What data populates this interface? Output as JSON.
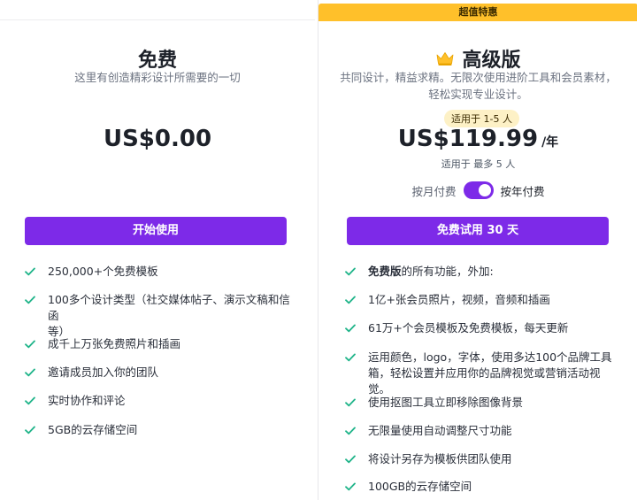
{
  "free": {
    "title": "免费",
    "subtitle": "这里有创造精彩设计所需要的一切",
    "price": "US$0.00",
    "cta": "开始使用",
    "features": [
      "250,000+个免费模板",
      "100多个设计类型（社交媒体帖子、演示文稿和信函",
      "等）",
      "成千上万张免费照片和插画",
      "邀请成员加入你的团队",
      "实时协作和评论",
      "5GB的云存储空间"
    ]
  },
  "pro": {
    "badge": "超值特惠",
    "title": "高级版",
    "subtitle_line1": "共同设计，精益求精。无限次使用进阶工具和会员素材，",
    "subtitle_line2": "轻松实现专业设计。",
    "seat_pill": "适用于 1-5 人",
    "price": "US$119.99",
    "price_unit": "/年",
    "seat_note_prefix": "适用于",
    "seat_note_value": "最多 5 人",
    "billing_monthly": "按月付费",
    "billing_yearly": "按年付费",
    "cta": "免费试用 30 天",
    "features": [
      {
        "bold": "免费版",
        "text": "的所有功能，外加:"
      },
      {
        "bold": "",
        "text": "1亿+张会员照片，视频，音频和插画"
      },
      {
        "bold": "",
        "text": "61万+个会员模板及免费模板，每天更新"
      },
      {
        "bold": "",
        "text": "运用颜色，logo，字体，使用多达100个品牌工具"
      },
      {
        "bold": "",
        "text": "箱，轻松设置并应用你的品牌视觉或营销活动视觉。"
      },
      {
        "bold": "",
        "text": "使用抠图工具立即移除图像背景"
      },
      {
        "bold": "",
        "text": "无限量使用自动调整尺寸功能"
      },
      {
        "bold": "",
        "text": "将设计另存为模板供团队使用"
      },
      {
        "bold": "",
        "text": "100GB的云存储空间"
      }
    ]
  },
  "colors": {
    "accent": "#7d2ae8",
    "badge": "#ffc02a",
    "check": "#1fb489",
    "seat_pill": "#fdf1c6"
  },
  "icons": {
    "check": "check-icon",
    "crown": "crown-icon",
    "toggle": "toggle-switch"
  }
}
